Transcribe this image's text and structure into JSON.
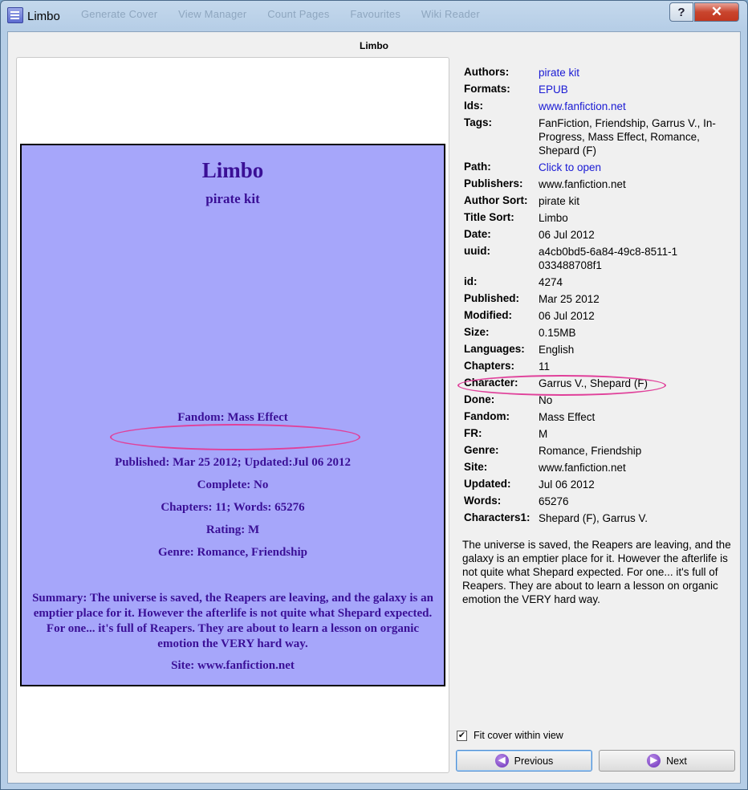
{
  "window": {
    "title": "Limbo",
    "background_menu": [
      "Generate Cover",
      "View Manager",
      "Count Pages",
      "Favourites",
      "Wiki Reader"
    ],
    "help_label": "?",
    "close_label": "✕"
  },
  "dialog": {
    "title": "Limbo"
  },
  "cover": {
    "title": "Limbo",
    "author": "pirate kit",
    "fandom": "Fandom: Mass Effect",
    "published": "Published: Mar 25 2012; Updated:Jul 06 2012",
    "complete": "Complete: No",
    "chapters": "Chapters: 11; Words: 65276",
    "rating": "Rating: M",
    "genre": "Genre: Romance, Friendship",
    "summary": "Summary: The universe is saved, the Reapers are leaving, and the galaxy is an emptier place for it. However the afterlife is not quite what Shepard expected. For one... it's full of Reapers. They are about to learn a lesson on organic emotion the VERY hard way.",
    "site": "Site: www.fanfiction.net"
  },
  "metadata": [
    {
      "label": "Authors:",
      "value": "pirate kit",
      "link": true
    },
    {
      "label": "Formats:",
      "value": "EPUB",
      "link": true
    },
    {
      "label": "Ids:",
      "value": "www.fanfiction.net",
      "link": true
    },
    {
      "label": "Tags:",
      "value": "FanFiction, Friendship, Garrus V., In-Progress, Mass Effect, Romance, Shepard (F)",
      "link": false
    },
    {
      "label": "Path:",
      "value": "Click to open",
      "link": true
    },
    {
      "label": "Publishers:",
      "value": "www.fanfiction.net",
      "link": false
    },
    {
      "label": "Author Sort:",
      "value": "pirate kit",
      "link": false
    },
    {
      "label": "Title Sort:",
      "value": "Limbo",
      "link": false
    },
    {
      "label": "Date:",
      "value": "06 Jul 2012",
      "link": false
    },
    {
      "label": "uuid:",
      "value": "a4cb0bd5-6a84-49c8-8511-1033488708f1",
      "link": false
    },
    {
      "label": "id:",
      "value": "4274",
      "link": false
    },
    {
      "label": "Published:",
      "value": "Mar 25 2012",
      "link": false
    },
    {
      "label": "Modified:",
      "value": "06 Jul 2012",
      "link": false
    },
    {
      "label": "Size:",
      "value": "0.15MB",
      "link": false
    },
    {
      "label": "Languages:",
      "value": "English",
      "link": false
    },
    {
      "label": "Chapters:",
      "value": "11",
      "link": false
    },
    {
      "label": "Character:",
      "value": "Garrus V., Shepard (F)",
      "link": false
    },
    {
      "label": "Done:",
      "value": "No",
      "link": false
    },
    {
      "label": "Fandom:",
      "value": "Mass Effect",
      "link": false
    },
    {
      "label": "FR:",
      "value": "M",
      "link": false
    },
    {
      "label": "Genre:",
      "value": "Romance, Friendship",
      "link": false
    },
    {
      "label": "Site:",
      "value": "www.fanfiction.net",
      "link": false
    },
    {
      "label": "Updated:",
      "value": "Jul 06 2012",
      "link": false
    },
    {
      "label": "Words:",
      "value": "65276",
      "link": false
    },
    {
      "label": "Characters1:",
      "value": "Shepard (F), Garrus V.",
      "link": false
    }
  ],
  "description": "The universe is saved, the Reapers are leaving, and the galaxy is an emptier place for it. However the afterlife is not quite what Shepard expected. For one... it's full of Reapers. They are about to learn a lesson on organic emotion the VERY hard way.",
  "fit_cover": {
    "label": "Fit cover within view",
    "checked": true
  },
  "buttons": {
    "previous": "Previous",
    "next": "Next"
  },
  "colors": {
    "link": "#1a1ad4",
    "cover_bg": "#a6a6fa",
    "cover_text": "#3a0f96",
    "annotation": "#e0409a"
  }
}
